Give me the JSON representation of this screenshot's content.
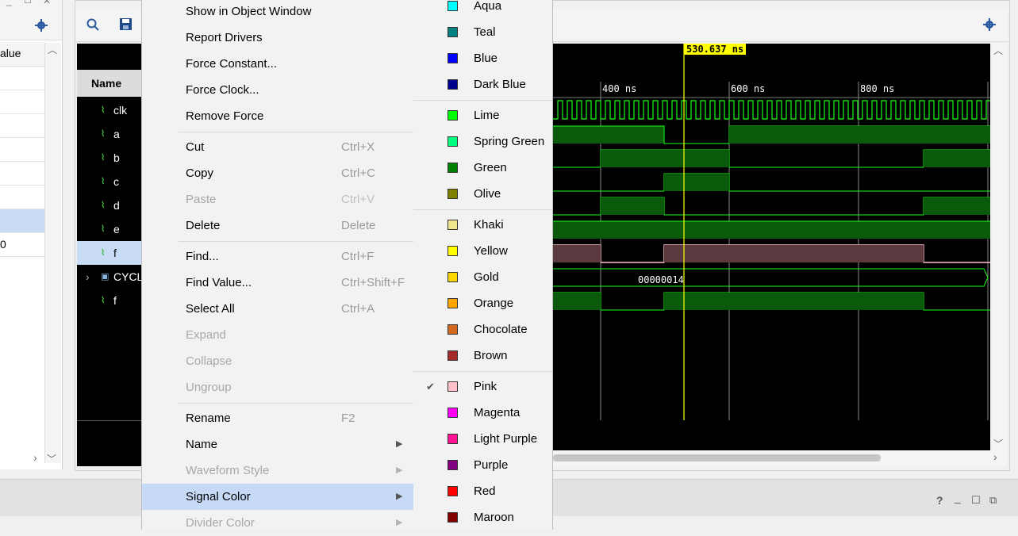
{
  "left_panel": {
    "header": "alue",
    "value_0": "0"
  },
  "wave": {
    "name_header": "Name",
    "signals": [
      {
        "label": "clk"
      },
      {
        "label": "a"
      },
      {
        "label": "b"
      },
      {
        "label": "c"
      },
      {
        "label": "d"
      },
      {
        "label": "e"
      },
      {
        "label": "f"
      },
      {
        "label": "CYCL"
      },
      {
        "label": "f"
      }
    ],
    "cursor_time": "530.637 ns",
    "ticks": [
      "400 ns",
      "600 ns",
      "800 ns"
    ],
    "bus_value": "00000014"
  },
  "menu": {
    "items": [
      {
        "label": "Show in Object Window"
      },
      {
        "label": "Report Drivers"
      },
      {
        "label": "Force Constant..."
      },
      {
        "label": "Force Clock..."
      },
      {
        "label": "Remove Force"
      },
      {
        "label": "Cut",
        "shortcut": "Ctrl+X"
      },
      {
        "label": "Copy",
        "shortcut": "Ctrl+C"
      },
      {
        "label": "Paste",
        "shortcut": "Ctrl+V"
      },
      {
        "label": "Delete",
        "shortcut": "Delete"
      },
      {
        "label": "Find...",
        "shortcut": "Ctrl+F"
      },
      {
        "label": "Find Value...",
        "shortcut": "Ctrl+Shift+F"
      },
      {
        "label": "Select All",
        "shortcut": "Ctrl+A"
      },
      {
        "label": "Expand"
      },
      {
        "label": "Collapse"
      },
      {
        "label": "Ungroup"
      },
      {
        "label": "Rename",
        "shortcut": "F2"
      },
      {
        "label": "Name"
      },
      {
        "label": "Waveform Style"
      },
      {
        "label": "Signal Color"
      },
      {
        "label": "Divider Color"
      }
    ]
  },
  "colors": {
    "items": [
      {
        "label": "Aqua",
        "hex": "#00ffff"
      },
      {
        "label": "Teal",
        "hex": "#008080"
      },
      {
        "label": "Blue",
        "hex": "#0000ff"
      },
      {
        "label": "Dark Blue",
        "hex": "#00008b"
      },
      {
        "label": "Lime",
        "hex": "#00ff00"
      },
      {
        "label": "Spring Green",
        "hex": "#00ff7f"
      },
      {
        "label": "Green",
        "hex": "#008000"
      },
      {
        "label": "Olive",
        "hex": "#808000"
      },
      {
        "label": "Khaki",
        "hex": "#f0e68c"
      },
      {
        "label": "Yellow",
        "hex": "#ffff00"
      },
      {
        "label": "Gold",
        "hex": "#ffd700"
      },
      {
        "label": "Orange",
        "hex": "#ffa500"
      },
      {
        "label": "Chocolate",
        "hex": "#d2691e"
      },
      {
        "label": "Brown",
        "hex": "#a52a2a"
      },
      {
        "label": "Pink",
        "hex": "#ffc0cb"
      },
      {
        "label": "Magenta",
        "hex": "#ff00ff"
      },
      {
        "label": "Light Purple",
        "hex": "#ff1493"
      },
      {
        "label": "Purple",
        "hex": "#800080"
      },
      {
        "label": "Red",
        "hex": "#ff0000"
      },
      {
        "label": "Maroon",
        "hex": "#800000"
      }
    ],
    "checkmark": "✔"
  },
  "bottom": {
    "help": "?",
    "minimize": "_",
    "restore": "☐",
    "float": "⧉"
  }
}
